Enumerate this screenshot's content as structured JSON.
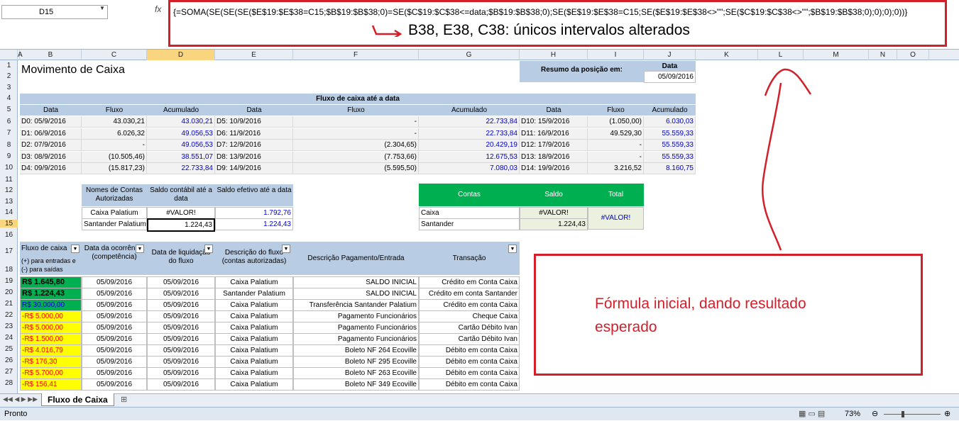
{
  "namebox": "D15",
  "fx": "fx",
  "formula": "{=SOMA(SE(SE(SE($E$19:$E$38=C15;$B$19:$B$38;0)=SE($C$19:$C$38<=data;$B$19:$B$38;0);SE($E$19:$E$38=C15;SE($E$19:$E$38<>\"\";SE($C$19:$C$38<>\"\";$B$19:$B$38;0);0);0);0))}",
  "annotation_top": "B38, E38, C38: únicos intervalos alterados",
  "annotation_box": "Fórmula inicial, dando resultado esperado",
  "columns": [
    "A",
    "B",
    "C",
    "D",
    "E",
    "F",
    "G",
    "H",
    "I",
    "J",
    "K",
    "L",
    "M",
    "N",
    "O"
  ],
  "rows": [
    "1",
    "2",
    "3",
    "4",
    "5",
    "6",
    "7",
    "8",
    "9",
    "10",
    "11",
    "12",
    "13",
    "14",
    "15",
    "16",
    "17",
    "18",
    "19",
    "20",
    "21",
    "22",
    "23",
    "24",
    "25",
    "26",
    "27",
    "28"
  ],
  "title": "Movimento de Caixa",
  "resumo_label": "Resumo da posição em:",
  "data_label": "Data",
  "data_value": "05/09/2016",
  "fluxo_title": "Fluxo de caixa até a data",
  "fluxo_headers": [
    "Data",
    "Fluxo",
    "Acumulado",
    "Data",
    "Fluxo",
    "Acumulado",
    "Data",
    "Fluxo",
    "Acumulado"
  ],
  "fluxo_rows": [
    [
      "D0: 05/9/2016",
      "43.030,21",
      "43.030,21",
      "D5: 10/9/2016",
      "-",
      "22.733,84",
      "D10: 15/9/2016",
      "(1.050,00)",
      "6.030,03"
    ],
    [
      "D1: 06/9/2016",
      "6.026,32",
      "49.056,53",
      "D6: 11/9/2016",
      "-",
      "22.733,84",
      "D11: 16/9/2016",
      "49.529,30",
      "55.559,33"
    ],
    [
      "D2: 07/9/2016",
      "-",
      "49.056,53",
      "D7: 12/9/2016",
      "(2.304,65)",
      "20.429,19",
      "D12: 17/9/2016",
      "-",
      "55.559,33"
    ],
    [
      "D3: 08/9/2016",
      "(10.505,46)",
      "38.551,07",
      "D8: 13/9/2016",
      "(7.753,66)",
      "12.675,53",
      "D13: 18/9/2016",
      "-",
      "55.559,33"
    ],
    [
      "D4: 09/9/2016",
      "(15.817,23)",
      "22.733,84",
      "D9: 14/9/2016",
      "(5.595,50)",
      "7.080,03",
      "D14: 19/9/2016",
      "3.216,52",
      "8.160,75"
    ]
  ],
  "contas_headers": [
    "Nomes de Contas Autorizadas",
    "Saldo contábil até a data",
    "Saldo efetivo até a data"
  ],
  "contas_rows": [
    [
      "Caixa Palatium",
      "#VALOR!",
      "1.792,76"
    ],
    [
      "Santander Palatium",
      "1.224,43",
      "1.224,43"
    ]
  ],
  "green_headers": [
    "Contas",
    "Saldo",
    "Total"
  ],
  "green_rows": [
    [
      "Caixa",
      "#VALOR!"
    ],
    [
      "Santander",
      "1.224,43"
    ]
  ],
  "green_total": "#VALOR!",
  "mov_headers": [
    "Fluxo de caixa",
    "(+) para entradas e (-) para saídas",
    "Data da ocorrência (competência)",
    "Data de liquidação do fluxo",
    "Descrição do fluxo (contas autorizadas)",
    "Descrição Pagamento/Entrada",
    "Transação"
  ],
  "mov_rows": [
    [
      "R$ 1.645,80",
      "05/09/2016",
      "05/09/2016",
      "Caixa Palatium",
      "SALDO INICIAL",
      "Crédito em Conta Caixa"
    ],
    [
      "R$ 1.224,43",
      "05/09/2016",
      "05/09/2016",
      "Santander Palatium",
      "SALDO INICIAL",
      "Crédito em conta Santander"
    ],
    [
      "R$ 30.000,00",
      "05/09/2016",
      "05/09/2016",
      "Caixa Palatium",
      "Transferência Santander Palatium",
      "Crédito em conta Caixa"
    ],
    [
      "-R$ 5.000,00",
      "05/09/2016",
      "05/09/2016",
      "Caixa Palatium",
      "Pagamento Funcionários",
      "Cheque Caixa"
    ],
    [
      "-R$ 5.000,00",
      "05/09/2016",
      "05/09/2016",
      "Caixa Palatium",
      "Pagamento Funcionários",
      "Cartão Débito Ivan"
    ],
    [
      "-R$ 1.500,00",
      "05/09/2016",
      "05/09/2016",
      "Caixa Palatium",
      "Pagamento Funcionários",
      "Cartão Débito Ivan"
    ],
    [
      "-R$ 4.016,79",
      "05/09/2016",
      "05/09/2016",
      "Caixa Palatium",
      "Boleto NF 264 Ecoville",
      "Débito em conta Caixa"
    ],
    [
      "-R$ 176,30",
      "05/09/2016",
      "05/09/2016",
      "Caixa Palatium",
      "Boleto NF 295 Ecoville",
      "Débito em conta Caixa"
    ],
    [
      "-R$ 5.700,00",
      "05/09/2016",
      "05/09/2016",
      "Caixa Palatium",
      "Boleto NF 263 Ecoville",
      "Débito em conta Caixa"
    ],
    [
      "-R$ 156,41",
      "05/09/2016",
      "05/09/2016",
      "Caixa Palatium",
      "Boleto NF 349 Ecoville",
      "Débito em conta Caixa"
    ]
  ],
  "sheet_tab": "Fluxo de Caixa",
  "status": "Pronto",
  "zoom": "73%",
  "colors": {
    "blue_text": "#0000cc",
    "green": "#00b050",
    "yellow": "#ffff00",
    "red": "#d31f2a"
  }
}
